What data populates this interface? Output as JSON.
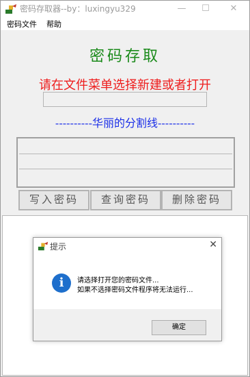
{
  "window": {
    "title": "密码存取器--by：luxingyu329",
    "minimize_glyph": "—",
    "maximize_glyph": "☐",
    "close_glyph": "✕"
  },
  "menu": {
    "items": [
      "密码文件",
      "帮助"
    ]
  },
  "main": {
    "title": "密码存取",
    "prompt": "请在文件菜单选择新建或者打开",
    "file_path_value": "",
    "divider": "----------华丽的分割线----------",
    "buttons": {
      "write": "写入密码",
      "query": "查询密码",
      "delete": "删除密码"
    }
  },
  "dialog": {
    "title": "提示",
    "close_glyph": "✕",
    "icon_glyph": "i",
    "line1": "请选择打开您的密码文件...",
    "line2": "如果不选择密码文件程序将无法运行...",
    "ok_label": "确定"
  },
  "colors": {
    "title_green": "#1a8a1a",
    "prompt_red": "#ee1c1c",
    "divider_blue": "#1a2ee8",
    "info_blue": "#1e6fcc"
  }
}
